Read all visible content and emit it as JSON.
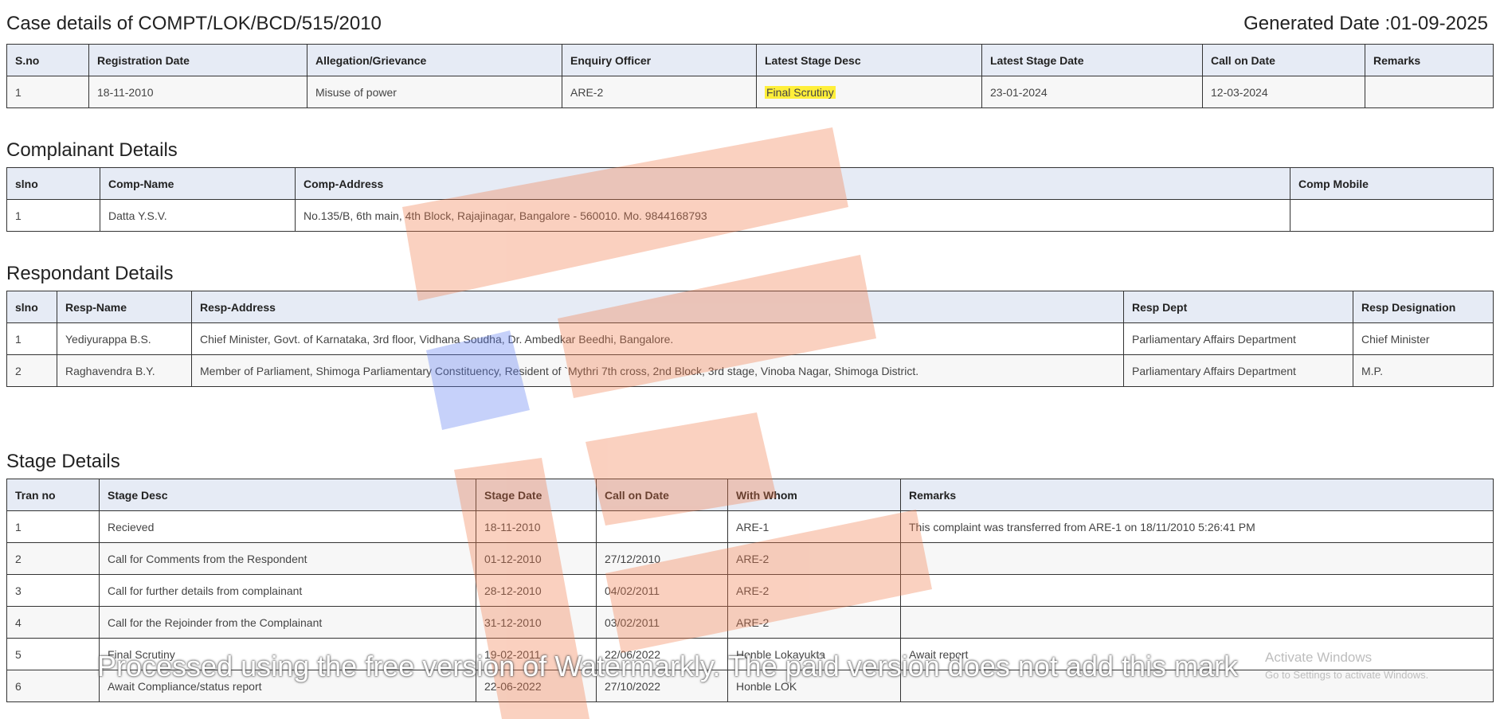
{
  "case": {
    "title": "Case details of COMPT/LOK/BCD/515/2010",
    "generated": "Generated Date :01-09-2025",
    "headers": [
      "S.no",
      "Registration Date",
      "Allegation/Grievance",
      "Enquiry Officer",
      "Latest Stage Desc",
      "Latest Stage Date",
      "Call on Date",
      "Remarks"
    ],
    "row": {
      "sno": "1",
      "reg_date": "18-11-2010",
      "allegation": "Misuse of power",
      "officer": "ARE-2",
      "stage_desc": "Final Scrutiny",
      "stage_date": "23-01-2024",
      "call_on": "12-03-2024",
      "remarks": ""
    }
  },
  "complainant": {
    "title": "Complainant Details",
    "headers": [
      "slno",
      "Comp-Name",
      "Comp-Address",
      "Comp Mobile"
    ],
    "rows": [
      {
        "slno": "1",
        "name": "Datta Y.S.V.",
        "address": "No.135/B, 6th main, 4th Block, Rajajinagar, Bangalore - 560010. Mo. 9844168793",
        "mobile": ""
      }
    ]
  },
  "respondent": {
    "title": "Respondant Details",
    "headers": [
      "slno",
      "Resp-Name",
      "Resp-Address",
      "Resp Dept",
      "Resp Designation"
    ],
    "rows": [
      {
        "slno": "1",
        "name": "Yediyurappa B.S.",
        "address": "Chief Minister, Govt. of Karnataka, 3rd floor, Vidhana Soudha, Dr. Ambedkar Beedhi, Bangalore.",
        "dept": "Parliamentary Affairs Department",
        "designation": "Chief Minister"
      },
      {
        "slno": "2",
        "name": "Raghavendra B.Y.",
        "address": "Member of Parliament, Shimoga Parliamentary Constituency, Resident of `Mythri 7th cross, 2nd Block, 3rd stage, Vinoba Nagar, Shimoga District.",
        "dept": "Parliamentary Affairs Department",
        "designation": "M.P."
      }
    ]
  },
  "stage": {
    "title": "Stage Details",
    "headers": [
      "Tran no",
      "Stage Desc",
      "Stage Date",
      "Call on Date",
      "With Whom",
      "Remarks"
    ],
    "rows": [
      {
        "tran": "1",
        "desc": "Recieved",
        "date": "18-11-2010",
        "call": "",
        "whom": "ARE-1",
        "remarks": "This complaint was transferred from ARE-1 on 18/11/2010 5:26:41 PM"
      },
      {
        "tran": "2",
        "desc": "Call for Comments from the Respondent",
        "date": "01-12-2010",
        "call": "27/12/2010",
        "whom": "ARE-2",
        "remarks": ""
      },
      {
        "tran": "3",
        "desc": "Call for further details from complainant",
        "date": "28-12-2010",
        "call": "04/02/2011",
        "whom": "ARE-2",
        "remarks": ""
      },
      {
        "tran": "4",
        "desc": "Call for the Rejoinder from the Complainant",
        "date": "31-12-2010",
        "call": "03/02/2011",
        "whom": "ARE-2",
        "remarks": ""
      },
      {
        "tran": "5",
        "desc": "Final Scrutiny",
        "date": "19-02-2011",
        "call": "22/06/2022",
        "whom": "Honble Lokayukta",
        "remarks": "Await report"
      },
      {
        "tran": "6",
        "desc": "Await Compliance/status report",
        "date": "22-06-2022",
        "call": "27/10/2022",
        "whom": "Honble LOK",
        "remarks": ""
      }
    ]
  },
  "overlay": {
    "watermark_text": "Processed using the free version of Watermarkly. The paid version does not add this mark",
    "windows_title": "Activate Windows",
    "windows_sub": "Go to Settings to activate Windows."
  }
}
